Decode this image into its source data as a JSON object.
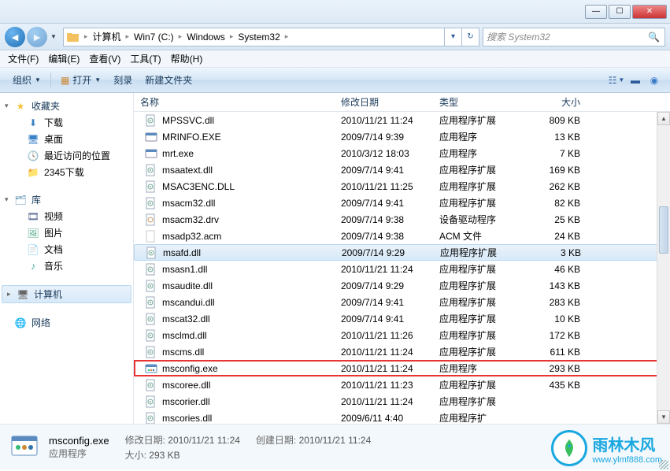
{
  "window_controls": {
    "min": "—",
    "max": "☐",
    "close": "✕"
  },
  "breadcrumb": {
    "segments": [
      "计算机",
      "Win7 (C:)",
      "Windows",
      "System32"
    ],
    "sep": "▸"
  },
  "search": {
    "placeholder": "搜索 System32"
  },
  "menubar": [
    "文件(F)",
    "编辑(E)",
    "查看(V)",
    "工具(T)",
    "帮助(H)"
  ],
  "toolbar": {
    "organize": "组织",
    "open": "打开",
    "burn": "刻录",
    "newfolder": "新建文件夹"
  },
  "sidebar": {
    "favorites": {
      "label": "收藏夹",
      "items": [
        "下载",
        "桌面",
        "最近访问的位置",
        "2345下载"
      ]
    },
    "libraries": {
      "label": "库",
      "items": [
        "视频",
        "图片",
        "文档",
        "音乐"
      ]
    },
    "computer": {
      "label": "计算机"
    },
    "network": {
      "label": "网络"
    }
  },
  "columns": {
    "name": "名称",
    "date": "修改日期",
    "type": "类型",
    "size": "大小"
  },
  "files": [
    {
      "name": "MPSSVC.dll",
      "date": "2010/11/21 11:24",
      "type": "应用程序扩展",
      "size": "809 KB",
      "ico": "dll"
    },
    {
      "name": "MRINFO.EXE",
      "date": "2009/7/14 9:39",
      "type": "应用程序",
      "size": "13 KB",
      "ico": "exe"
    },
    {
      "name": "mrt.exe",
      "date": "2010/3/12 18:03",
      "type": "应用程序",
      "size": "7 KB",
      "ico": "exe"
    },
    {
      "name": "msaatext.dll",
      "date": "2009/7/14 9:41",
      "type": "应用程序扩展",
      "size": "169 KB",
      "ico": "dll"
    },
    {
      "name": "MSAC3ENC.DLL",
      "date": "2010/11/21 11:25",
      "type": "应用程序扩展",
      "size": "262 KB",
      "ico": "dll"
    },
    {
      "name": "msacm32.dll",
      "date": "2009/7/14 9:41",
      "type": "应用程序扩展",
      "size": "82 KB",
      "ico": "dll"
    },
    {
      "name": "msacm32.drv",
      "date": "2009/7/14 9:38",
      "type": "设备驱动程序",
      "size": "25 KB",
      "ico": "drv"
    },
    {
      "name": "msadp32.acm",
      "date": "2009/7/14 9:38",
      "type": "ACM 文件",
      "size": "24 KB",
      "ico": "acm"
    },
    {
      "name": "msafd.dll",
      "date": "2009/7/14 9:29",
      "type": "应用程序扩展",
      "size": "3 KB",
      "ico": "dll",
      "sel": true
    },
    {
      "name": "msasn1.dll",
      "date": "2010/11/21 11:24",
      "type": "应用程序扩展",
      "size": "46 KB",
      "ico": "dll"
    },
    {
      "name": "msaudite.dll",
      "date": "2009/7/14 9:29",
      "type": "应用程序扩展",
      "size": "143 KB",
      "ico": "dll"
    },
    {
      "name": "mscandui.dll",
      "date": "2009/7/14 9:41",
      "type": "应用程序扩展",
      "size": "283 KB",
      "ico": "dll"
    },
    {
      "name": "mscat32.dll",
      "date": "2009/7/14 9:41",
      "type": "应用程序扩展",
      "size": "10 KB",
      "ico": "dll"
    },
    {
      "name": "msclmd.dll",
      "date": "2010/11/21 11:26",
      "type": "应用程序扩展",
      "size": "172 KB",
      "ico": "dll"
    },
    {
      "name": "mscms.dll",
      "date": "2010/11/21 11:24",
      "type": "应用程序扩展",
      "size": "611 KB",
      "ico": "dll"
    },
    {
      "name": "msconfig.exe",
      "date": "2010/11/21 11:24",
      "type": "应用程序",
      "size": "293 KB",
      "ico": "cfg",
      "highlight": true
    },
    {
      "name": "mscoree.dll",
      "date": "2010/11/21 11:23",
      "type": "应用程序扩展",
      "size": "435 KB",
      "ico": "dll"
    },
    {
      "name": "mscorier.dll",
      "date": "2010/11/21 11:24",
      "type": "应用程序扩展",
      "size": "",
      "ico": "dll"
    },
    {
      "name": "mscories.dll",
      "date": "2009/6/11 4:40",
      "type": "应用程序扩",
      "size": "",
      "ico": "dll"
    }
  ],
  "details": {
    "filename": "msconfig.exe",
    "filetype": "应用程序",
    "mod_label": "修改日期:",
    "mod_value": "2010/11/21 11:24",
    "size_label": "大小:",
    "size_value": "293 KB",
    "create_label": "创建日期:",
    "create_value": "2010/11/21 11:24"
  },
  "watermark": {
    "text": "雨林木风",
    "url": "www.ylmf888.com"
  }
}
